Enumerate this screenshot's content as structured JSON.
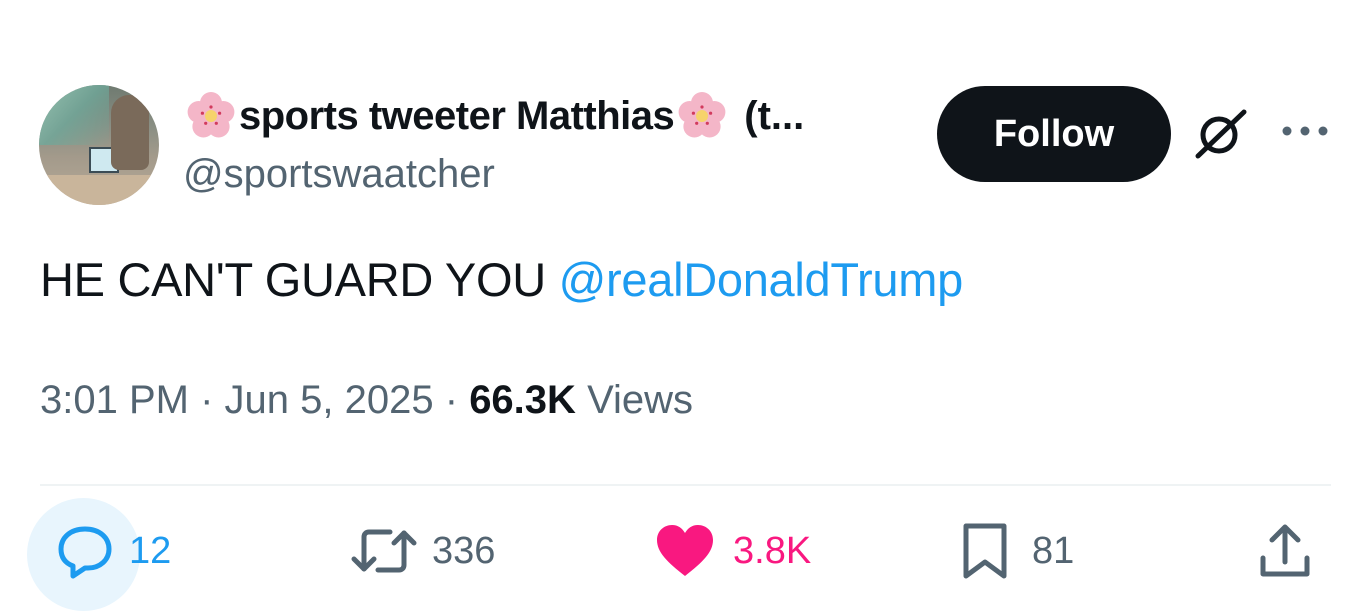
{
  "author": {
    "display_name": "sports tweeter Matthias",
    "name_suffix": "(t...",
    "handle": "@sportswaatcher"
  },
  "follow_button": {
    "label": "Follow"
  },
  "tweet": {
    "text": "HE CAN'T GUARD YOU",
    "mention": "@realDonaldTrump"
  },
  "meta": {
    "time": "3:01 PM",
    "separator": "·",
    "date": "Jun 5, 2025",
    "views_count": "66.3K",
    "views_label": "Views"
  },
  "actions": {
    "replies": "12",
    "reposts": "336",
    "likes": "3.8K",
    "bookmarks": "81"
  },
  "icons": {
    "author_emoji": "cherry-blossom-icon",
    "grok": "grok-icon",
    "more": "more-icon",
    "reply": "reply-icon",
    "repost": "repost-icon",
    "like": "heart-icon",
    "bookmark": "bookmark-icon",
    "share": "share-icon"
  },
  "colors": {
    "accent": "#1d9bf0",
    "like": "#f91880",
    "text": "#0f1419",
    "secondary": "#536471",
    "follow_bg": "#0f1419"
  }
}
